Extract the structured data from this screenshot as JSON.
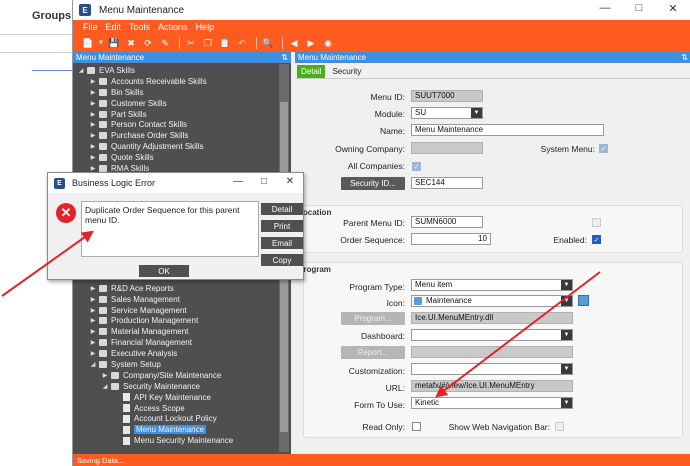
{
  "background": {
    "heading": "Groups"
  },
  "window": {
    "title": "Menu Maintenance"
  },
  "menubar": [
    "File",
    "Edit",
    "Tools",
    "Actions",
    "Help"
  ],
  "left_pane": {
    "header": "Menu Maintenance",
    "pin_icon": "pin-icon",
    "tree": [
      {
        "label": "EVA Skills",
        "level": 0,
        "kind": "folder",
        "expanded": true
      },
      {
        "label": "Accounts Receivable Skills",
        "level": 1,
        "kind": "folder"
      },
      {
        "label": "Bin Skills",
        "level": 1,
        "kind": "folder"
      },
      {
        "label": "Customer Skills",
        "level": 1,
        "kind": "folder"
      },
      {
        "label": "Part Skills",
        "level": 1,
        "kind": "folder"
      },
      {
        "label": "Person Contact Skills",
        "level": 1,
        "kind": "folder"
      },
      {
        "label": "Purchase Order Skills",
        "level": 1,
        "kind": "folder"
      },
      {
        "label": "Quantity Adjustment Skills",
        "level": 1,
        "kind": "folder"
      },
      {
        "label": "Quote Skills",
        "level": 1,
        "kind": "folder"
      },
      {
        "label": "RMA Skills",
        "level": 1,
        "kind": "folder"
      },
      {
        "label": "",
        "level": 1,
        "kind": "hidden"
      },
      {
        "label": "",
        "level": 1,
        "kind": "hidden"
      },
      {
        "label": "",
        "level": 1,
        "kind": "hidden"
      },
      {
        "label": "",
        "level": 1,
        "kind": "hidden"
      },
      {
        "label": "",
        "level": 1,
        "kind": "hidden"
      },
      {
        "label": "",
        "level": 1,
        "kind": "hidden"
      },
      {
        "label": "",
        "level": 1,
        "kind": "hidden"
      },
      {
        "label": "",
        "level": 1,
        "kind": "hidden"
      },
      {
        "label": "",
        "level": 1,
        "kind": "hidden"
      },
      {
        "label": "",
        "level": 1,
        "kind": "hidden"
      },
      {
        "label": "R&D Ace Reports",
        "level": 1,
        "kind": "folder"
      },
      {
        "label": "Sales Management",
        "level": 1,
        "kind": "folder"
      },
      {
        "label": "Service Management",
        "level": 1,
        "kind": "folder"
      },
      {
        "label": "Production Management",
        "level": 1,
        "kind": "folder"
      },
      {
        "label": "Material Management",
        "level": 1,
        "kind": "folder"
      },
      {
        "label": "Financial Management",
        "level": 1,
        "kind": "folder"
      },
      {
        "label": "Executive Analysis",
        "level": 1,
        "kind": "folder"
      },
      {
        "label": "System Setup",
        "level": 1,
        "kind": "folder",
        "expanded": true
      },
      {
        "label": "Company/Site Maintenance",
        "level": 2,
        "kind": "folder"
      },
      {
        "label": "Security Maintenance",
        "level": 2,
        "kind": "folder",
        "expanded": true
      },
      {
        "label": "API Key Maintenance",
        "level": 3,
        "kind": "doc"
      },
      {
        "label": "Access Scope",
        "level": 3,
        "kind": "doc"
      },
      {
        "label": "Account Lockout Policy",
        "level": 3,
        "kind": "doc"
      },
      {
        "label": "Menu Maintenance",
        "level": 3,
        "kind": "doc",
        "selected": true
      },
      {
        "label": "Menu Security Maintenance",
        "level": 3,
        "kind": "doc"
      }
    ]
  },
  "right_pane": {
    "header": "Menu Maintenance",
    "tabs": [
      "Detail",
      "Security"
    ],
    "general": {
      "menu_id_label": "Menu ID:",
      "menu_id": "SUUT7000",
      "module_label": "Module:",
      "module": "SU",
      "name_label": "Name:",
      "name": "Menu Maintenance",
      "owning_company_label": "Owning Company:",
      "owning_company": "",
      "system_menu_label": "System Menu:",
      "all_companies_label": "All Companies:",
      "security_id_button": "Security ID...",
      "security_id": "SEC144"
    },
    "location": {
      "title": "Location",
      "parent_label": "Parent Menu ID:",
      "parent": "SUMN6000",
      "order_label": "Order Sequence:",
      "order": "10",
      "enabled_label": "Enabled:"
    },
    "program": {
      "title": "Program",
      "type_label": "Program Type:",
      "type": "Menu item",
      "icon_label": "Icon:",
      "icon": "Maintenance",
      "program_button": "Program...",
      "program": "Ice.UI.MenuMEntry.dll",
      "dashboard_label": "Dashboard:",
      "dashboard": "",
      "report_button": "Report...",
      "report": "",
      "customization_label": "Customization:",
      "customization": "",
      "url_label": "URL:",
      "url": "metafx/#/view/Ice.UI.MenuMEntry",
      "form_label": "Form To Use:",
      "form": "Kinetic",
      "readonly_label": "Read Only:",
      "webnav_label": "Show Web Navigation Bar:"
    }
  },
  "status": "Saving Data...",
  "dialog": {
    "title": "Business Logic Error",
    "message": "Duplicate Order Sequence for this parent menu ID.",
    "buttons": [
      "Detail",
      "Print",
      "Email",
      "Copy"
    ],
    "ok": "OK"
  },
  "colors": {
    "accent": "#ff5a1f",
    "selection": "#3d8fe0",
    "tab_active": "#4caf1a",
    "arrow": "#e0242a"
  }
}
